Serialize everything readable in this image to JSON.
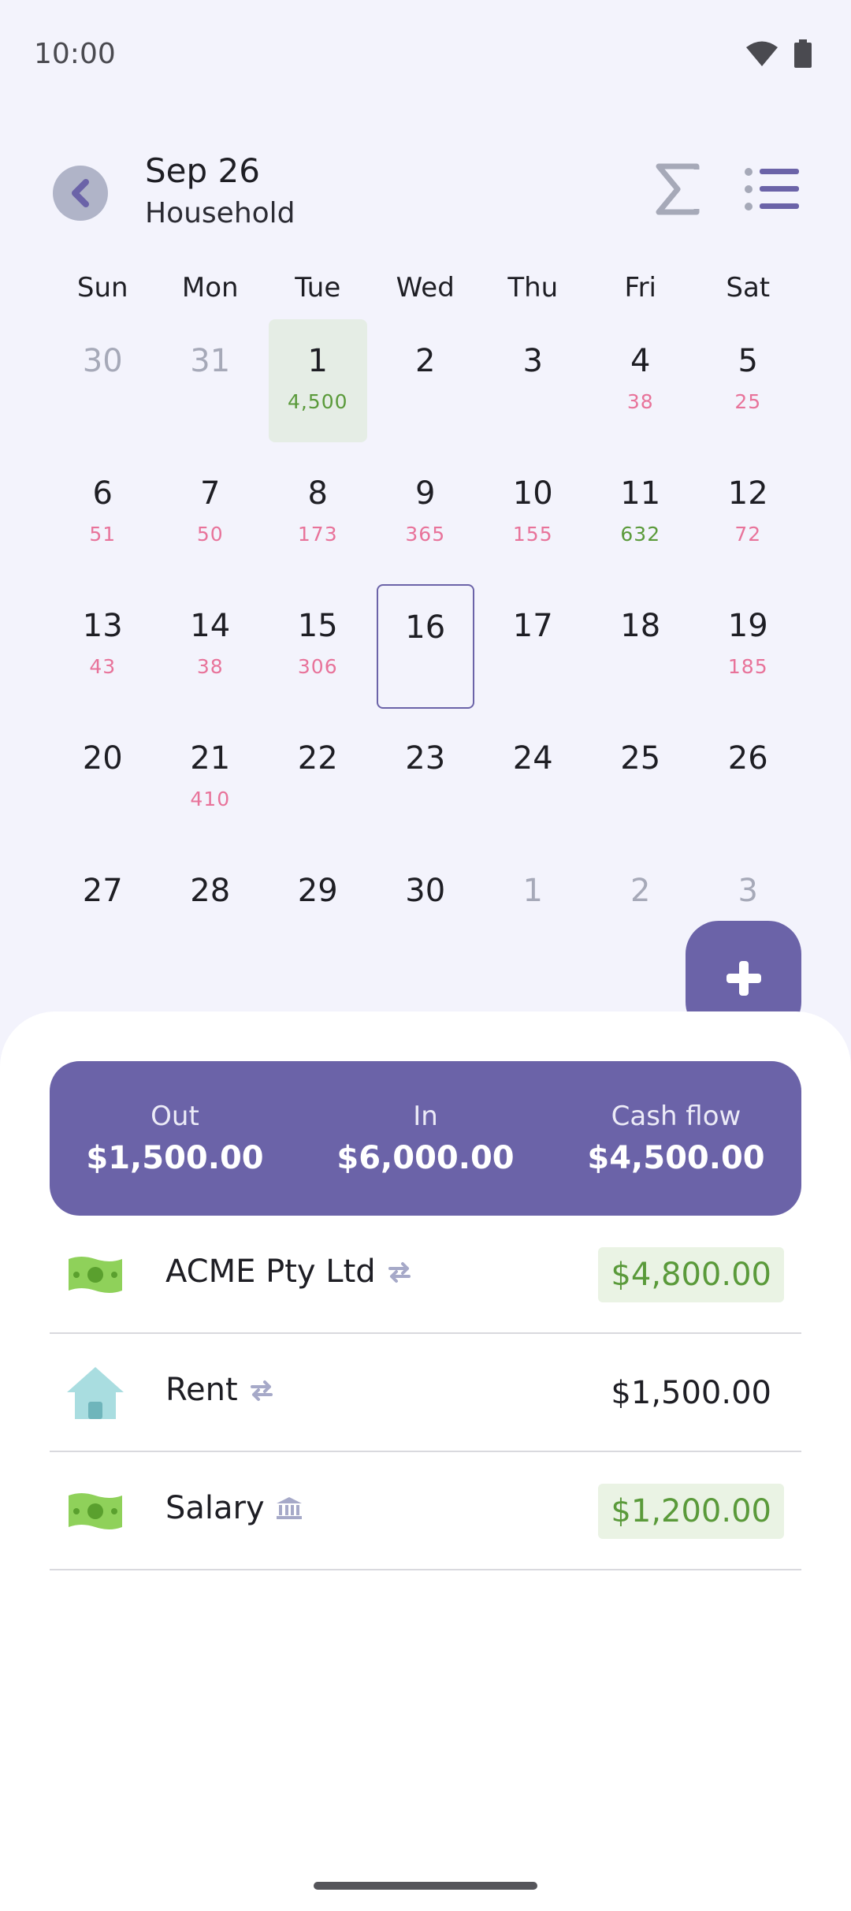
{
  "status": {
    "time": "10:00"
  },
  "header": {
    "title": "Sep 26",
    "subtitle": "Household"
  },
  "calendar": {
    "weekdays": [
      "Sun",
      "Mon",
      "Tue",
      "Wed",
      "Thu",
      "Fri",
      "Sat"
    ],
    "weeks": [
      [
        {
          "day": "30",
          "muted": true
        },
        {
          "day": "31",
          "muted": true
        },
        {
          "day": "1",
          "amount": "4,500",
          "positive": true,
          "highlight": true
        },
        {
          "day": "2"
        },
        {
          "day": "3"
        },
        {
          "day": "4",
          "amount": "38"
        },
        {
          "day": "5",
          "amount": "25"
        }
      ],
      [
        {
          "day": "6",
          "amount": "51"
        },
        {
          "day": "7",
          "amount": "50"
        },
        {
          "day": "8",
          "amount": "173"
        },
        {
          "day": "9",
          "amount": "365"
        },
        {
          "day": "10",
          "amount": "155"
        },
        {
          "day": "11",
          "amount": "632",
          "positive": true
        },
        {
          "day": "12",
          "amount": "72"
        }
      ],
      [
        {
          "day": "13",
          "amount": "43"
        },
        {
          "day": "14",
          "amount": "38"
        },
        {
          "day": "15",
          "amount": "306"
        },
        {
          "day": "16",
          "selected": true
        },
        {
          "day": "17"
        },
        {
          "day": "18"
        },
        {
          "day": "19",
          "amount": "185"
        }
      ],
      [
        {
          "day": "20"
        },
        {
          "day": "21",
          "amount": "410"
        },
        {
          "day": "22"
        },
        {
          "day": "23"
        },
        {
          "day": "24"
        },
        {
          "day": "25"
        },
        {
          "day": "26"
        }
      ],
      [
        {
          "day": "27"
        },
        {
          "day": "28"
        },
        {
          "day": "29"
        },
        {
          "day": "30"
        },
        {
          "day": "1",
          "muted": true
        },
        {
          "day": "2",
          "muted": true
        },
        {
          "day": "3",
          "muted": true
        }
      ]
    ]
  },
  "fab": {
    "icon": "plus-icon"
  },
  "summary": {
    "out_label": "Out",
    "out_value": "$1,500.00",
    "in_label": "In",
    "in_value": "$6,000.00",
    "flow_label": "Cash flow",
    "flow_value": "$4,500.00"
  },
  "transactions": [
    {
      "name": "ACME Pty Ltd",
      "icon": "money-icon",
      "badge": "repeat-icon",
      "amount": "$4,800.00",
      "positive": true
    },
    {
      "name": "Rent",
      "icon": "house-icon",
      "badge": "repeat-icon",
      "amount": "$1,500.00",
      "positive": false
    },
    {
      "name": "Salary",
      "icon": "money-icon",
      "badge": "bank-icon",
      "amount": "$1,200.00",
      "positive": true
    }
  ],
  "colors": {
    "accent": "#6b63a8",
    "negative": "#e8739a",
    "positive": "#5a9a3a",
    "background": "#f3f3fc"
  }
}
